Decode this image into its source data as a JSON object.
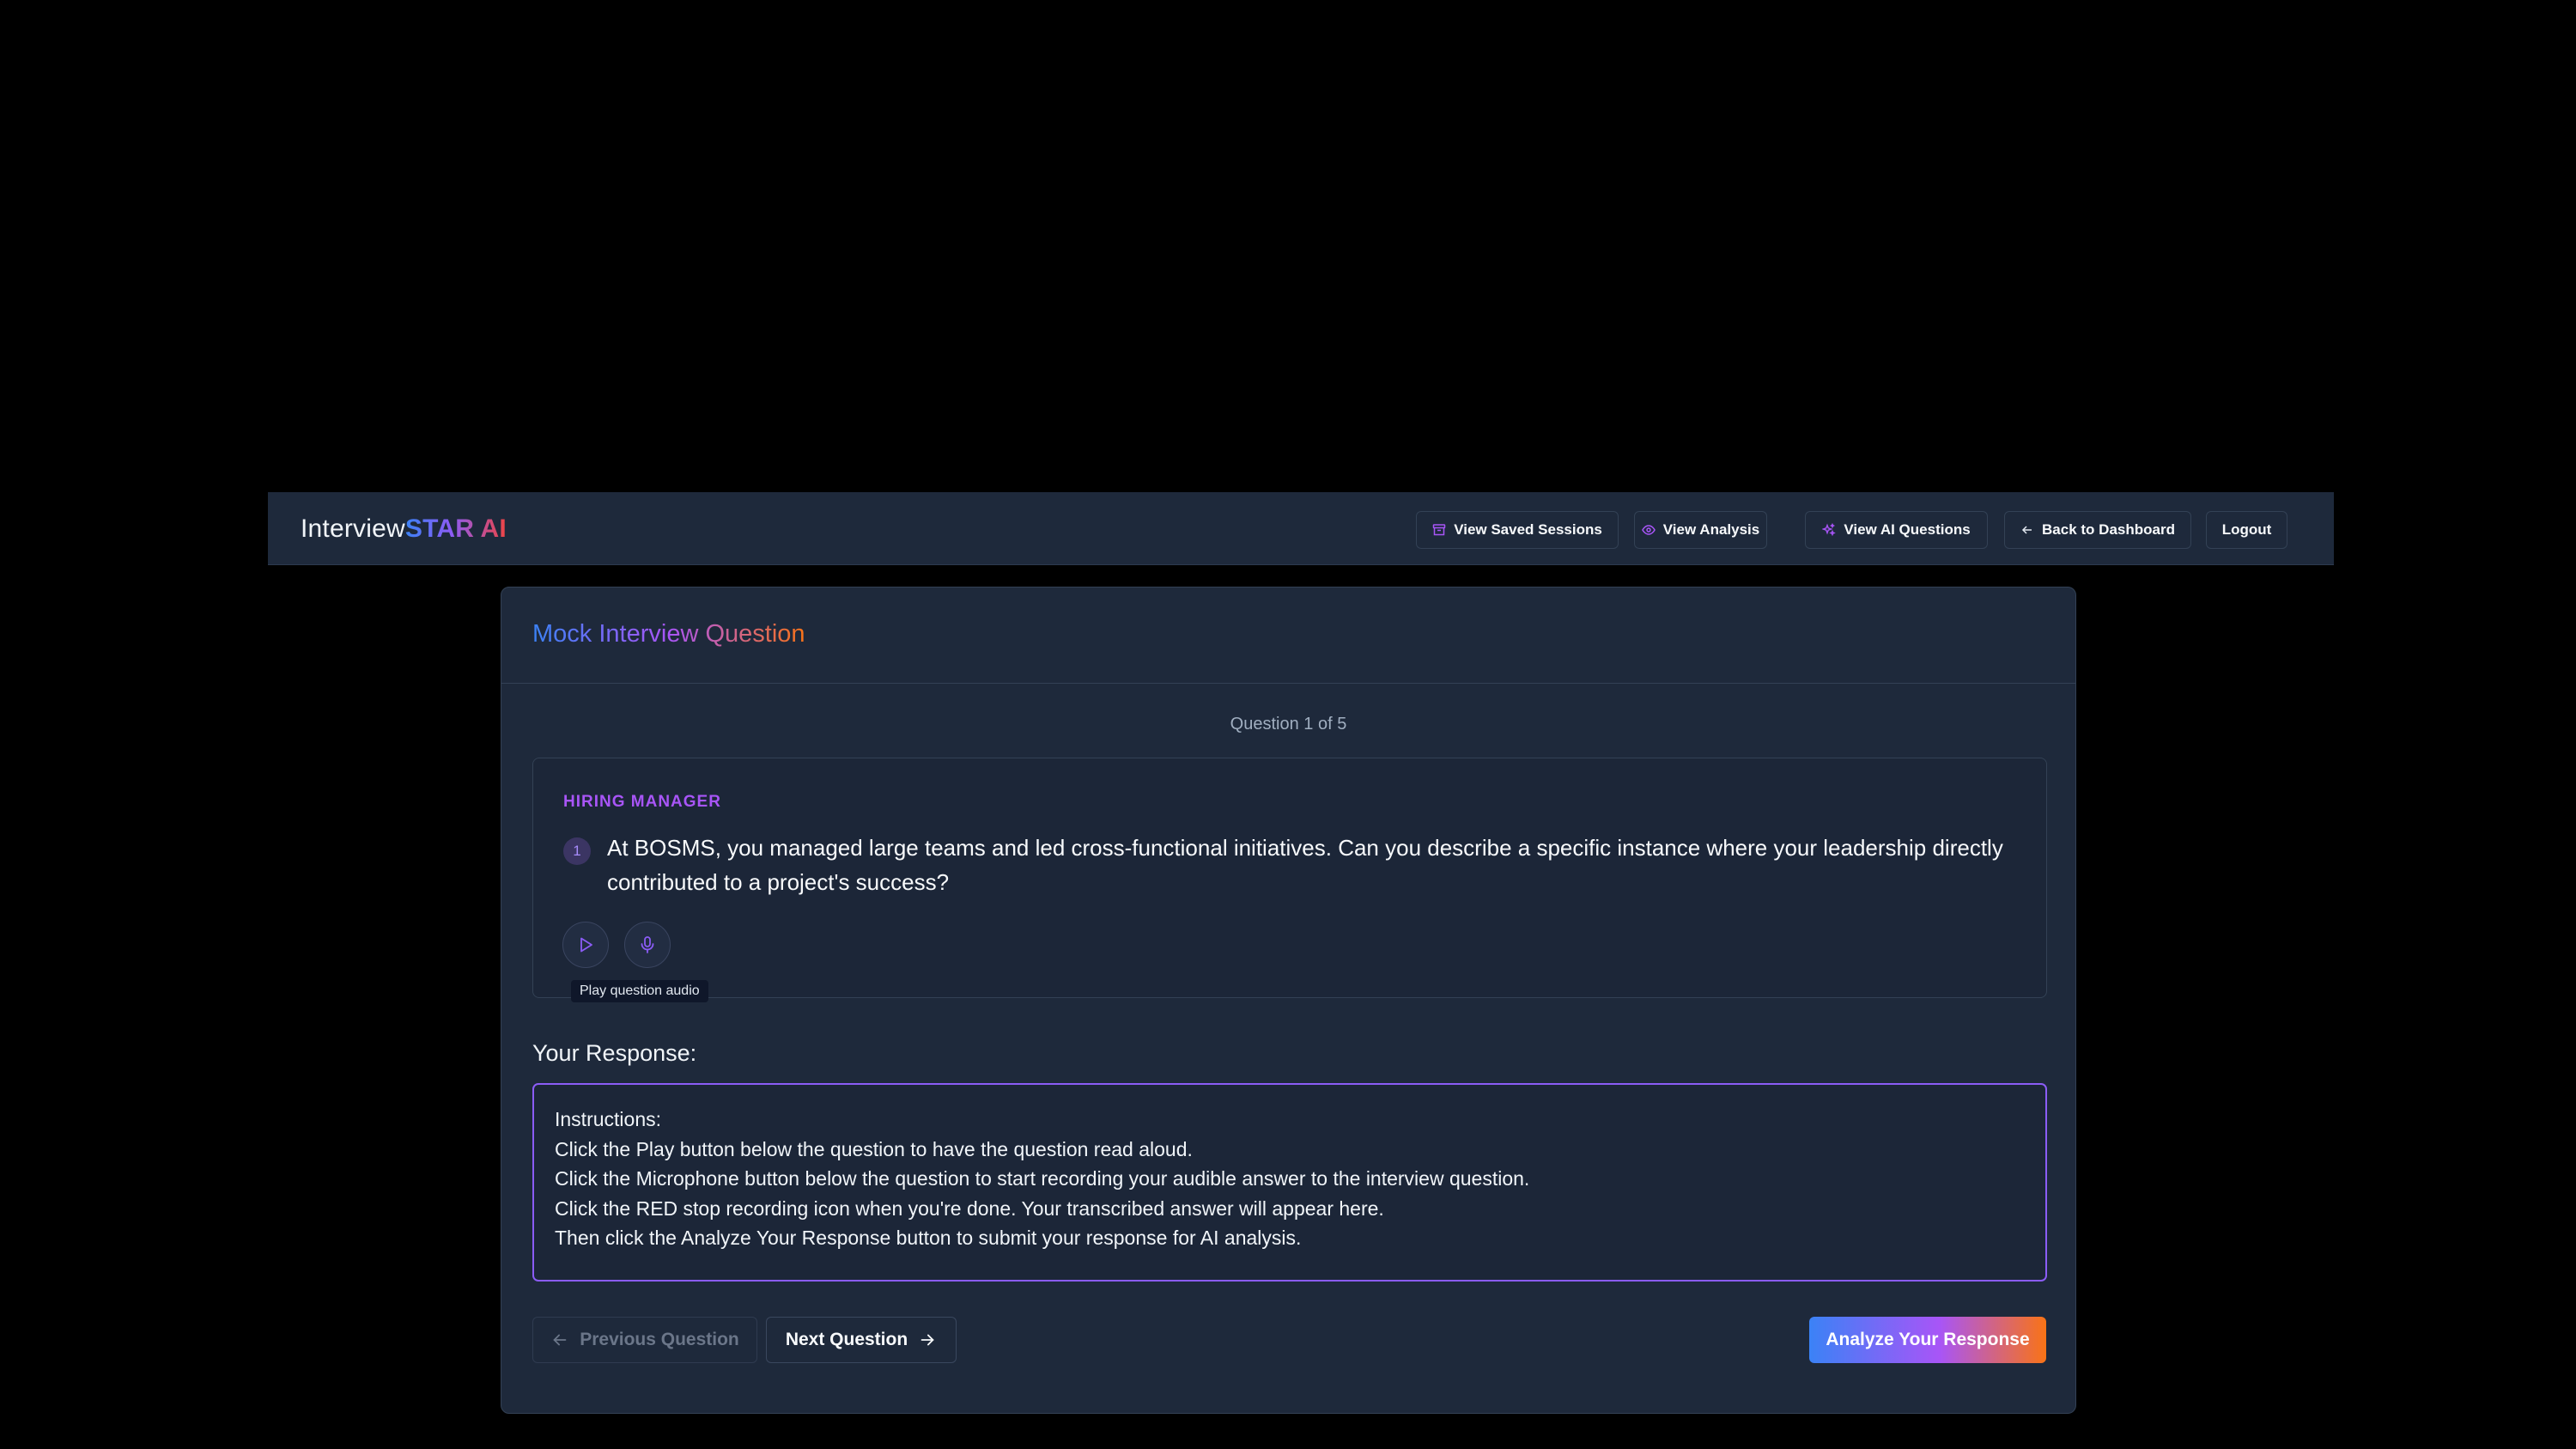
{
  "brand": {
    "prefix": "Interview",
    "highlight": "STAR AI"
  },
  "nav": {
    "saved_sessions": "View Saved Sessions",
    "analysis": "View Analysis",
    "ai_questions": "View AI Questions",
    "dashboard": "Back to Dashboard",
    "logout": "Logout"
  },
  "card": {
    "title": "Mock Interview Question",
    "progress": "Question 1 of 5",
    "question": {
      "persona": "HIRING MANAGER",
      "number": "1",
      "text": "At BOSMS, you managed large teams and led cross-functional initiatives. Can you describe a specific instance where your leadership directly contributed to a project's success?",
      "tooltip": "Play question audio"
    },
    "response": {
      "label": "Your Response:",
      "lines": [
        "Instructions:",
        "Click the Play button below the question to have the question read aloud.",
        "Click the Microphone button below the question to start recording your audible answer to the interview question.",
        "Click the RED stop recording icon when you're done. Your transcribed answer will appear here.",
        "Then click the Analyze Your Response button to submit your response for AI analysis."
      ]
    },
    "buttons": {
      "previous": "Previous Question",
      "next": "Next Question",
      "analyze": "Analyze Your Response"
    }
  },
  "colors": {
    "page_bg": "#000000",
    "panel_bg": "#1e293b",
    "accent_purple": "#8b5cf6",
    "accent_blue": "#3b82f6",
    "accent_orange": "#f97316"
  }
}
